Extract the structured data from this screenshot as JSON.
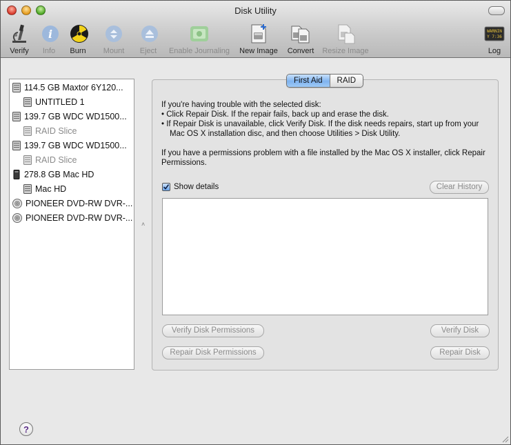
{
  "window": {
    "title": "Disk Utility"
  },
  "toolbar": [
    {
      "label": "Verify",
      "icon": "microscope-icon",
      "enabled": true
    },
    {
      "label": "Info",
      "icon": "info-icon",
      "enabled": false
    },
    {
      "label": "Burn",
      "icon": "burn-icon",
      "enabled": true
    },
    {
      "label": "Mount",
      "icon": "mount-icon",
      "enabled": false
    },
    {
      "label": "Eject",
      "icon": "eject-icon",
      "enabled": false
    },
    {
      "label": "Enable Journaling",
      "icon": "journaling-icon",
      "enabled": false
    },
    {
      "label": "New Image",
      "icon": "new-image-icon",
      "enabled": true
    },
    {
      "label": "Convert",
      "icon": "convert-icon",
      "enabled": true
    },
    {
      "label": "Resize Image",
      "icon": "resize-image-icon",
      "enabled": false
    },
    {
      "label": "Log",
      "icon": "log-icon",
      "log_screen_text": "WARNIN\nY 7:36",
      "enabled": true
    }
  ],
  "sidebar": {
    "items": [
      {
        "label": "114.5 GB Maxtor 6Y120...",
        "type": "disk",
        "indent": false,
        "dimmed": false
      },
      {
        "label": "UNTITLED 1",
        "type": "volume",
        "indent": true,
        "dimmed": false
      },
      {
        "label": "139.7 GB WDC WD1500...",
        "type": "disk",
        "indent": false,
        "dimmed": false
      },
      {
        "label": "RAID Slice",
        "type": "volume",
        "indent": true,
        "dimmed": true
      },
      {
        "label": "139.7 GB WDC WD1500...",
        "type": "disk",
        "indent": false,
        "dimmed": false
      },
      {
        "label": "RAID Slice",
        "type": "volume",
        "indent": true,
        "dimmed": true
      },
      {
        "label": "278.8 GB Mac HD",
        "type": "raid",
        "indent": false,
        "dimmed": false
      },
      {
        "label": "Mac HD",
        "type": "volume",
        "indent": true,
        "dimmed": false
      },
      {
        "label": "PIONEER DVD-RW DVR-...",
        "type": "optical",
        "indent": false,
        "dimmed": false
      },
      {
        "label": "PIONEER DVD-RW DVR-...",
        "type": "optical",
        "indent": false,
        "dimmed": false
      }
    ]
  },
  "tabs": [
    {
      "label": "First Aid",
      "active": true
    },
    {
      "label": "RAID",
      "active": false
    }
  ],
  "first_aid": {
    "intro": "If you're having trouble with the selected disk:",
    "bullet1": "• Click Repair Disk. If the repair fails, back up and erase the disk.",
    "bullet2": "• If Repair Disk is unavailable, click Verify Disk. If the disk needs repairs, start up from your Mac OS X installation disc, and then choose Utilities > Disk Utility.",
    "permissions": "If you have a permissions problem with a file installed by the Mac OS X installer, click Repair Permissions.",
    "show_details_label": "Show details",
    "show_details_checked": true,
    "clear_history": "Clear History",
    "verify_permissions": "Verify Disk Permissions",
    "repair_permissions": "Repair Disk Permissions",
    "verify_disk": "Verify Disk",
    "repair_disk": "Repair Disk"
  },
  "help": {
    "label": "?"
  },
  "colors": {
    "tab_active": "#8cbcf2",
    "disabled_text": "#8a8a8a"
  }
}
